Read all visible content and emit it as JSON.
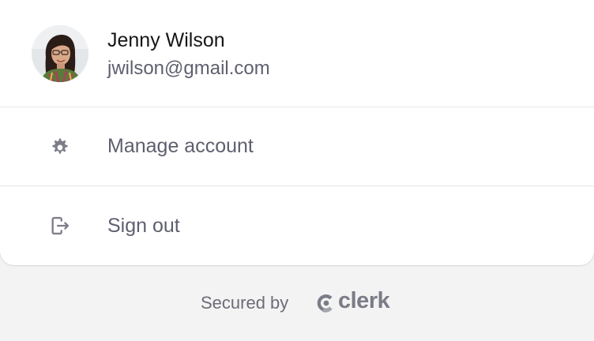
{
  "user": {
    "name": "Jenny Wilson",
    "email": "jwilson@gmail.com",
    "avatar_icon": "user-avatar-photo"
  },
  "actions": [
    {
      "label": "Manage account",
      "icon": "gear-icon"
    },
    {
      "label": "Sign out",
      "icon": "sign-out-icon"
    }
  ],
  "footer": {
    "secured_by_label": "Secured by",
    "brand_name": "clerk",
    "brand_icon": "clerk-logo-icon"
  },
  "colors": {
    "card_background": "#ffffff",
    "footer_background": "#f3f3f3",
    "primary_text": "#161616",
    "secondary_text": "#5e5f6e",
    "icon_color": "#7d7e8a",
    "divider": "#e6e6e6"
  }
}
